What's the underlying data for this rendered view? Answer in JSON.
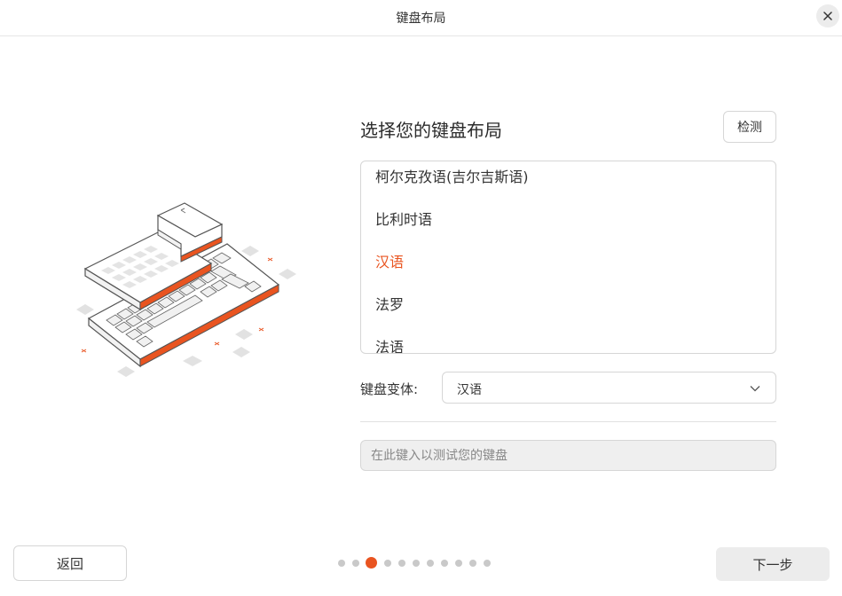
{
  "window": {
    "title": "键盘布局"
  },
  "heading": "选择您的键盘布局",
  "detect_button": "检测",
  "layouts": [
    {
      "label": "柯尔克孜语(吉尔吉斯语)",
      "selected": false
    },
    {
      "label": "比利时语",
      "selected": false
    },
    {
      "label": "汉语",
      "selected": true
    },
    {
      "label": "法罗",
      "selected": false
    },
    {
      "label": "法语",
      "selected": false
    }
  ],
  "variant": {
    "label": "键盘变体:",
    "value": "汉语"
  },
  "test_input": {
    "placeholder": "在此键入以测试您的键盘",
    "value": ""
  },
  "footer": {
    "back_label": "返回",
    "next_label": "下一步"
  },
  "progress": {
    "total_steps": 11,
    "current_step": 3
  },
  "colors": {
    "accent": "#e95420",
    "selected_text": "#e95420",
    "button_bg": "#ececec",
    "border": "#d6d6d6"
  },
  "icons": {
    "close": "close-icon",
    "dropdown": "chevron-down-icon",
    "illustration": "keyboard-illustration"
  }
}
